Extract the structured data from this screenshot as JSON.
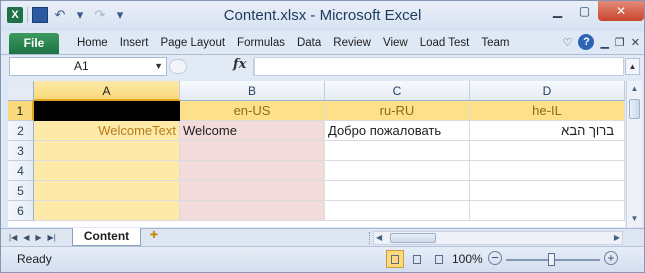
{
  "window": {
    "title": "Content.xlsx  -  Microsoft Excel"
  },
  "qat": {
    "app_icon_letter": "X"
  },
  "ribbon": {
    "file_label": "File",
    "tabs": [
      "Home",
      "Insert",
      "Page Layout",
      "Formulas",
      "Data",
      "Review",
      "View",
      "Load Test",
      "Team"
    ]
  },
  "formula_bar": {
    "name_box": "A1",
    "fx_label": "fx",
    "formula": ""
  },
  "grid": {
    "columns": [
      "A",
      "B",
      "C",
      "D"
    ],
    "rows": [
      "1",
      "2",
      "3",
      "4",
      "5",
      "6"
    ],
    "row1": {
      "A": "",
      "B": "en-US",
      "C": "ru-RU",
      "D": "he-IL"
    },
    "row2": {
      "A": "WelcomeText",
      "B": "Welcome",
      "C": "Добро пожаловать",
      "D": "ברוך הבא"
    }
  },
  "sheets": {
    "active": "Content"
  },
  "status": {
    "ready": "Ready",
    "zoom": "100%"
  },
  "colors": {
    "file_tab": "#1e7145",
    "col_a_fill": "#fde9a8",
    "col_b_fill": "#f2dcdb",
    "header_fill": "#ffe08a"
  }
}
